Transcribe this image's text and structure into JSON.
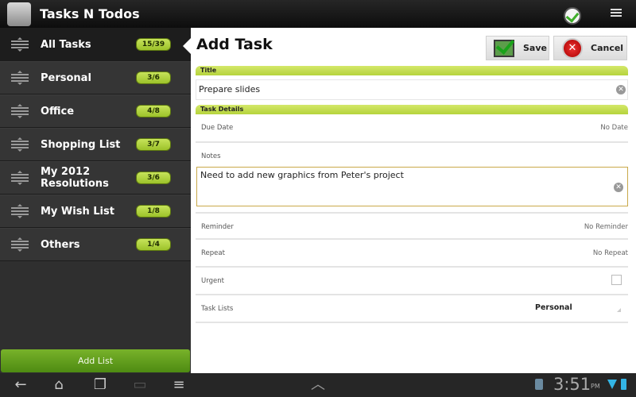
{
  "app": {
    "title": "Tasks N Todos",
    "icon": "clock-check-icon",
    "menu_icon": "overflow-menu-icon"
  },
  "sidebar": {
    "items": [
      {
        "label": "All Tasks",
        "count": "15/39",
        "active": true
      },
      {
        "label": "Personal",
        "count": "3/6"
      },
      {
        "label": "Office",
        "count": "4/8"
      },
      {
        "label": "Shopping List",
        "count": "3/7"
      },
      {
        "label": "My 2012 Resolutions",
        "count": "3/6"
      },
      {
        "label": "My Wish List",
        "count": "1/8"
      },
      {
        "label": "Others",
        "count": "1/4"
      }
    ],
    "add_list_label": "Add List"
  },
  "main": {
    "title": "Add Task",
    "save_label": "Save",
    "cancel_label": "Cancel",
    "sections": {
      "title": "Title",
      "details": "Task Details"
    },
    "title_value": "Prepare slides",
    "due_date": {
      "label": "Due Date",
      "value": "No Date"
    },
    "notes": {
      "label": "Notes",
      "value": "Need to add new graphics from Peter's project"
    },
    "reminder": {
      "label": "Reminder",
      "value": "No Reminder"
    },
    "repeat": {
      "label": "Repeat",
      "value": "No Repeat"
    },
    "urgent": {
      "label": "Urgent",
      "checked": false
    },
    "task_lists": {
      "label": "Task Lists",
      "value": "Personal"
    }
  },
  "system": {
    "time": "3:51",
    "ampm": "PM"
  },
  "colors": {
    "accent": "#b5d33c",
    "badge": "#c7e35a",
    "add_list": "#5f9b1c",
    "status_blue": "#33b5e5"
  }
}
